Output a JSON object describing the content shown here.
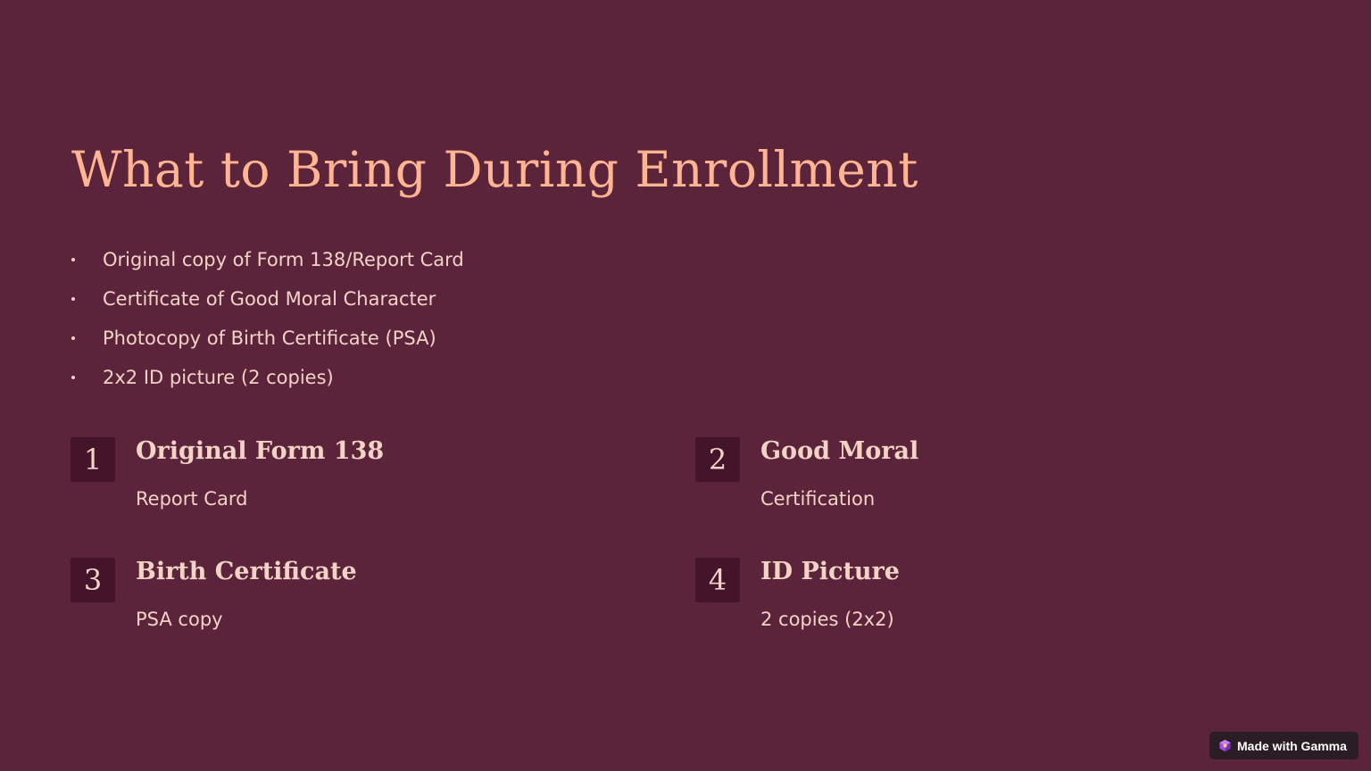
{
  "title": "What to Bring During Enrollment",
  "bullets": [
    "Original copy of Form 138/Report Card",
    "Certificate of Good Moral Character",
    "Photocopy of Birth Certificate (PSA)",
    "2x2 ID picture (2 copies)"
  ],
  "cards": [
    {
      "number": "1",
      "title": "Original Form 138",
      "description": "Report Card"
    },
    {
      "number": "2",
      "title": "Good Moral",
      "description": "Certification"
    },
    {
      "number": "3",
      "title": "Birth Certificate",
      "description": "PSA copy"
    },
    {
      "number": "4",
      "title": "ID Picture",
      "description": "2 copies (2x2)"
    }
  ],
  "badge": {
    "label": "Made with Gamma",
    "icon": "gamma-logo-icon"
  },
  "colors": {
    "background": "#5c243b",
    "title": "#ffb592",
    "text": "#f4d3c7",
    "number_box": "#44142a",
    "badge_bg": "#2a1d24"
  }
}
